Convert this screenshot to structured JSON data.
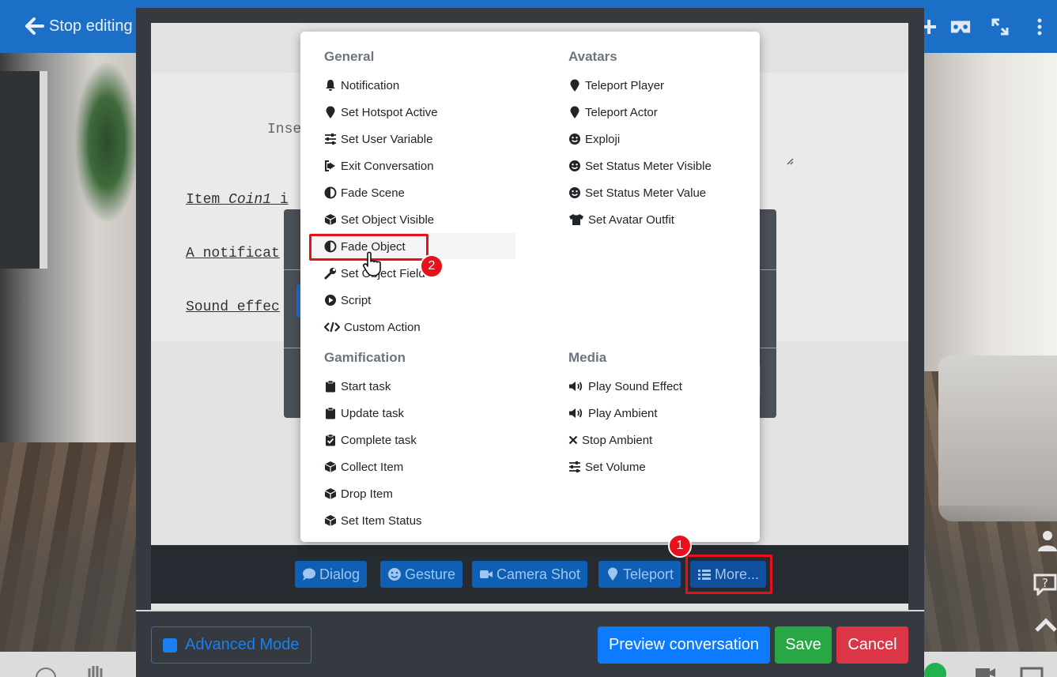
{
  "topbar": {
    "stop_editing": "Stop editing"
  },
  "editor": {
    "insert_hint": "Inse",
    "line1_prefix": "Item ",
    "line1_item": "Coin1",
    "line1_suffix": " i",
    "line2": "A notificat",
    "line3": "Sound effec"
  },
  "menu": {
    "general": {
      "heading": "General",
      "items": [
        {
          "label": "Notification",
          "icon": "bell-icon"
        },
        {
          "label": "Set Hotspot Active",
          "icon": "map-marker-icon"
        },
        {
          "label": "Set User Variable",
          "icon": "sliders-icon"
        },
        {
          "label": "Exit Conversation",
          "icon": "sign-out-icon"
        },
        {
          "label": "Fade Scene",
          "icon": "half-circle-icon"
        },
        {
          "label": "Set Object Visible",
          "icon": "cube-icon"
        },
        {
          "label": "Fade Object",
          "icon": "half-circle-icon"
        },
        {
          "label": "Set Object Field",
          "icon": "wrench-icon"
        },
        {
          "label": "Script",
          "icon": "play-circle-icon"
        },
        {
          "label": "Custom Action",
          "icon": "code-icon"
        }
      ]
    },
    "avatars": {
      "heading": "Avatars",
      "items": [
        {
          "label": "Teleport Player",
          "icon": "map-marker-icon"
        },
        {
          "label": "Teleport Actor",
          "icon": "map-marker-icon"
        },
        {
          "label": "Exploji",
          "icon": "smile-icon"
        },
        {
          "label": "Set Status Meter Visible",
          "icon": "smile-icon"
        },
        {
          "label": "Set Status Meter Value",
          "icon": "smile-icon"
        },
        {
          "label": "Set Avatar Outfit",
          "icon": "tshirt-icon"
        }
      ]
    },
    "gamification": {
      "heading": "Gamification",
      "items": [
        {
          "label": "Start task",
          "icon": "clipboard-icon"
        },
        {
          "label": "Update task",
          "icon": "clipboard-icon"
        },
        {
          "label": "Complete task",
          "icon": "clipboard-check-icon"
        },
        {
          "label": "Collect Item",
          "icon": "cube-icon"
        },
        {
          "label": "Drop Item",
          "icon": "cube-icon"
        },
        {
          "label": "Set Item Status",
          "icon": "cube-icon"
        }
      ]
    },
    "media": {
      "heading": "Media",
      "items": [
        {
          "label": "Play Sound Effect",
          "icon": "volume-icon"
        },
        {
          "label": "Play Ambient",
          "icon": "volume-icon"
        },
        {
          "label": "Stop Ambient",
          "icon": "times-icon"
        },
        {
          "label": "Set Volume",
          "icon": "sliders-icon"
        }
      ]
    }
  },
  "action_bar": {
    "dialog": "Dialog",
    "gesture": "Gesture",
    "camera_shot": "Camera Shot",
    "teleport": "Teleport",
    "more": "More..."
  },
  "footer": {
    "advanced_mode": "Advanced Mode",
    "preview": "Preview conversation",
    "save": "Save",
    "cancel": "Cancel"
  },
  "annotations": {
    "badge1": "1",
    "badge2": "2"
  },
  "colors": {
    "topbar": "#1b6fc7",
    "modal": "#343a40",
    "primary": "#0d7bff",
    "success": "#28a745",
    "danger": "#dc3545",
    "annotation": "#e8101a"
  }
}
